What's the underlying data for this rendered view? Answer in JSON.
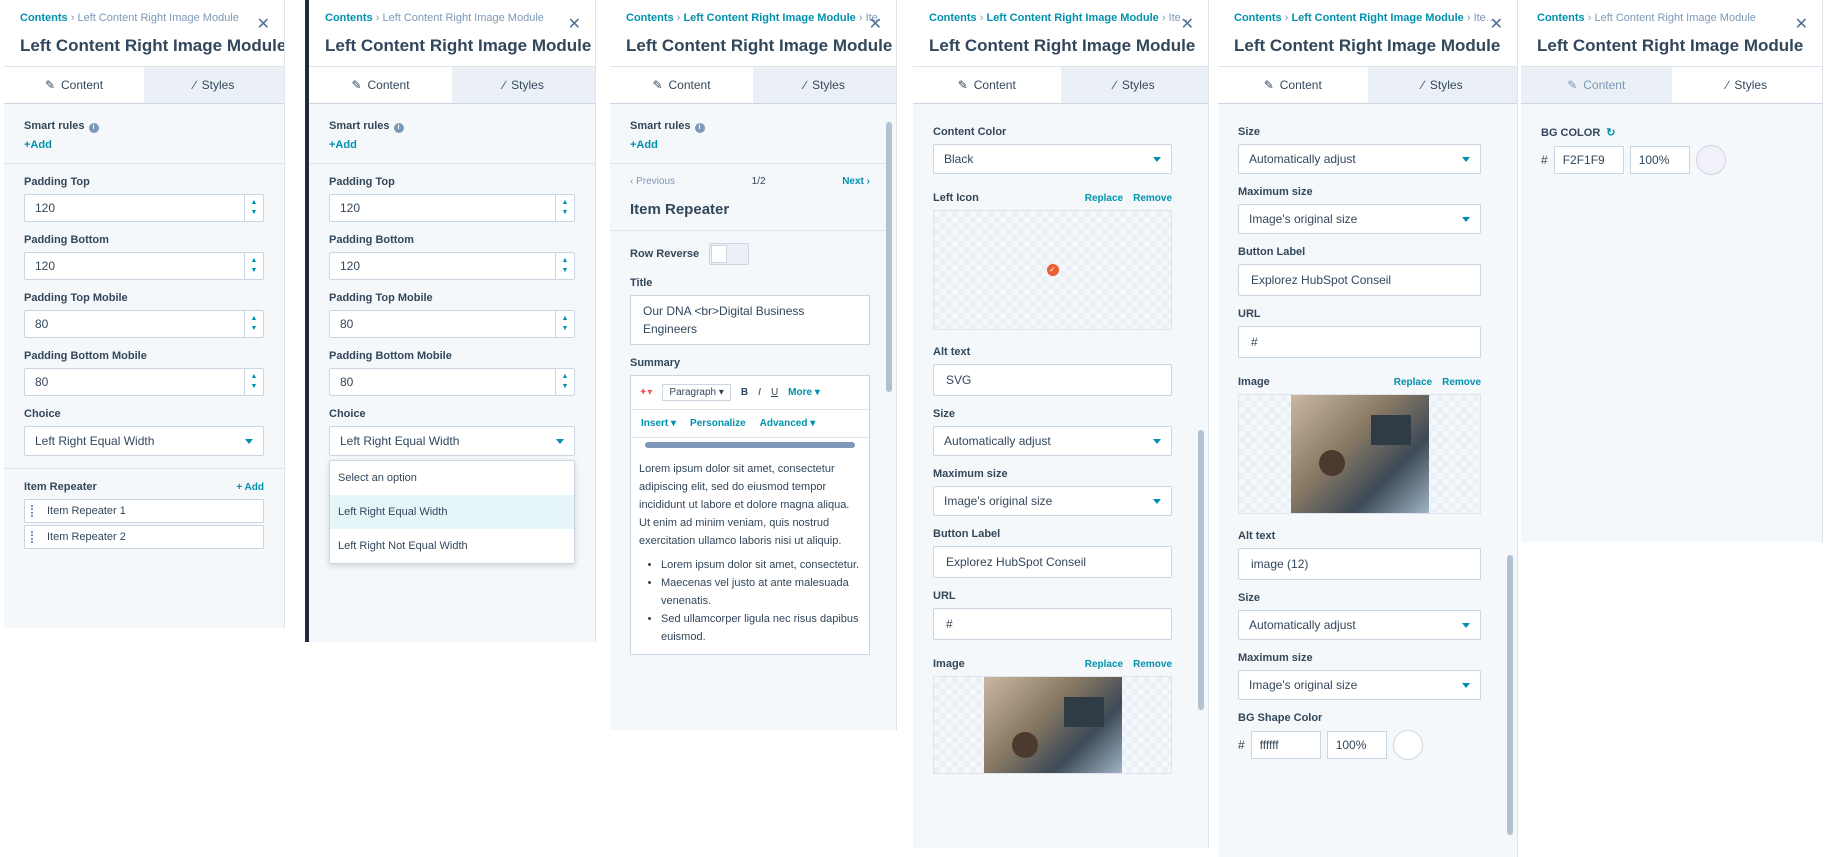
{
  "common": {
    "breadcrumb_root": "Contents",
    "breadcrumb_module": "Left Content Right Image Module",
    "breadcrumb_item": "Ite…",
    "title": "Left Content Right Image Module",
    "tab_content": "Content",
    "tab_styles": "Styles"
  },
  "p1": {
    "smart_rules": "Smart rules",
    "add": "+Add",
    "fields": [
      {
        "label": "Padding Top",
        "value": "120"
      },
      {
        "label": "Padding Bottom",
        "value": "120"
      },
      {
        "label": "Padding Top Mobile",
        "value": "80"
      },
      {
        "label": "Padding Bottom Mobile",
        "value": "80"
      }
    ],
    "choice_label": "Choice",
    "choice_value": "Left Right Equal Width",
    "repeater_label": "Item Repeater",
    "repeater_add": "+ Add",
    "repeater_items": [
      "Item Repeater 1",
      "Item Repeater 2"
    ]
  },
  "p2": {
    "smart_rules": "Smart rules",
    "add": "+Add",
    "fields": [
      {
        "label": "Padding Top",
        "value": "120"
      },
      {
        "label": "Padding Bottom",
        "value": "120"
      },
      {
        "label": "Padding Top Mobile",
        "value": "80"
      },
      {
        "label": "Padding Bottom Mobile",
        "value": "80"
      }
    ],
    "choice_label": "Choice",
    "choice_value": "Left Right Equal Width",
    "options": [
      "Select an option",
      "Left Right Equal Width",
      "Left Right Not Equal Width"
    ]
  },
  "p3": {
    "smart_rules": "Smart rules",
    "add": "+Add",
    "previous": "Previous",
    "page": "1/2",
    "next": "Next",
    "section_title": "Item Repeater",
    "row_reverse": "Row Reverse",
    "title_label": "Title",
    "title_value": "Our DNA <br>Digital Business Engineers",
    "summary_label": "Summary",
    "toolbar": {
      "paragraph": "Paragraph",
      "bold": "B",
      "italic": "I",
      "underline": "U",
      "more": "More",
      "insert": "Insert",
      "personalize": "Personalize",
      "advanced": "Advanced"
    },
    "paragraph": "Lorem ipsum dolor sit amet, consectetur adipiscing elit, sed do eiusmod tempor incididunt ut labore et dolore magna aliqua. Ut enim ad minim veniam, quis nostrud exercitation ullamco laboris nisi ut aliquip.",
    "bullets": [
      "Lorem ipsum dolor sit amet, consectetur.",
      "Maecenas vel justo at ante malesuada venenatis.",
      "Sed ullamcorper ligula nec risus dapibus euismod."
    ]
  },
  "p4": {
    "content_color_label": "Content Color",
    "content_color": "Black",
    "left_icon_label": "Left Icon",
    "replace": "Replace",
    "remove": "Remove",
    "alt_label": "Alt text",
    "alt_value": "SVG",
    "size_label": "Size",
    "size_value": "Automatically adjust",
    "max_label": "Maximum size",
    "max_value": "Image's original size",
    "button_label": "Button Label",
    "button_value": "Explorez HubSpot Conseil",
    "url_label": "URL",
    "url_value": "#",
    "image_label": "Image"
  },
  "p5": {
    "size_label": "Size",
    "size_value": "Automatically adjust",
    "max_label": "Maximum size",
    "max_value": "Image's original size",
    "button_label": "Button Label",
    "button_value": "Explorez HubSpot Conseil",
    "url_label": "URL",
    "url_value": "#",
    "image_label": "Image",
    "replace": "Replace",
    "remove": "Remove",
    "alt_label": "Alt text",
    "alt_value": "image (12)",
    "size2_label": "Size",
    "size2_value": "Automatically adjust",
    "max2_label": "Maximum size",
    "max2_value": "Image's original size",
    "bg_label": "BG Shape Color",
    "hash": "#",
    "bg_hex": "ffffff",
    "bg_pct": "100%"
  },
  "p6": {
    "bg_label": "BG COLOR",
    "hash": "#",
    "hex": "F2F1F9",
    "pct": "100%"
  },
  "colors": {
    "accent": "#0091ae",
    "text": "#33475b",
    "swatch": "#f2f1f9"
  }
}
